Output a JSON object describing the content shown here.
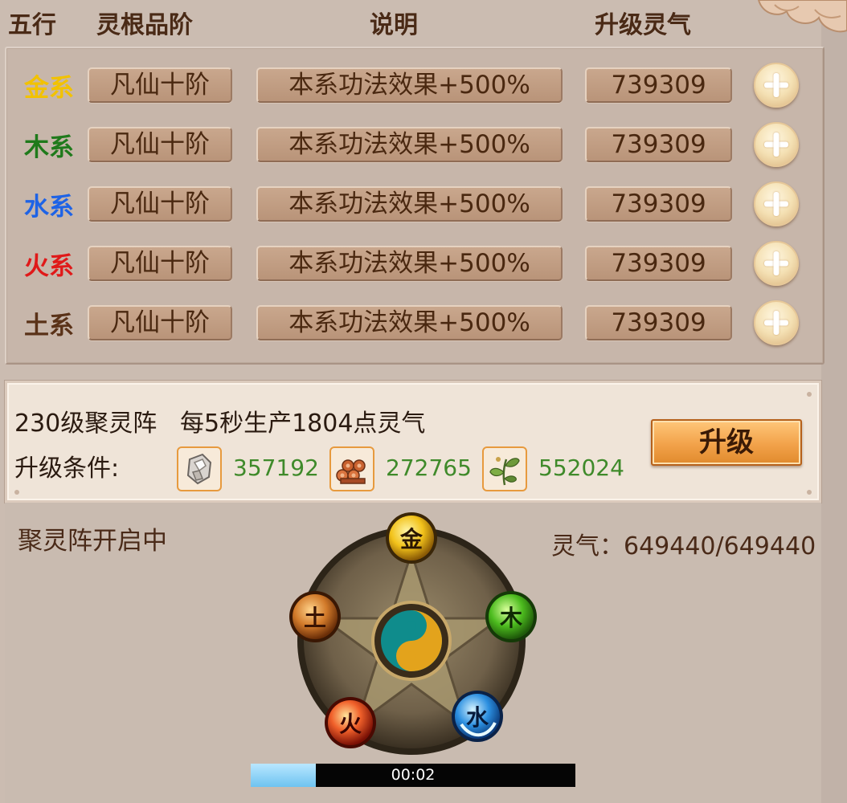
{
  "header": {
    "col_element": "五行",
    "col_rank": "灵根品阶",
    "col_desc": "说明",
    "col_cost": "升级灵气"
  },
  "elements": [
    {
      "name": "金系",
      "rank": "凡仙十阶",
      "desc": "本系功法效果+500%",
      "cost": "739309",
      "color": "#f2c200"
    },
    {
      "name": "木系",
      "rank": "凡仙十阶",
      "desc": "本系功法效果+500%",
      "cost": "739309",
      "color": "#1f7a1b"
    },
    {
      "name": "水系",
      "rank": "凡仙十阶",
      "desc": "本系功法效果+500%",
      "cost": "739309",
      "color": "#1e63e6"
    },
    {
      "name": "火系",
      "rank": "凡仙十阶",
      "desc": "本系功法效果+500%",
      "cost": "739309",
      "color": "#e01919"
    },
    {
      "name": "土系",
      "rank": "凡仙十阶",
      "desc": "本系功法效果+500%",
      "cost": "739309",
      "color": "#5a3218"
    }
  ],
  "formation": {
    "title": "230级聚灵阵",
    "production": "每5秒生产1804点灵气",
    "req_label": "升级条件:",
    "requirements": [
      {
        "icon": "ore-icon",
        "amount": "357192"
      },
      {
        "icon": "wood-logs-icon",
        "amount": "272765"
      },
      {
        "icon": "herb-icon",
        "amount": "552024"
      }
    ],
    "upgrade_label": "升级"
  },
  "status": {
    "text": "聚灵阵开启中",
    "qi": "灵气：649440/649440"
  },
  "wheel": {
    "nodes": [
      {
        "name": "金",
        "icon": "gold-orb-icon"
      },
      {
        "name": "木",
        "icon": "wood-orb-icon"
      },
      {
        "name": "水",
        "icon": "water-orb-icon"
      },
      {
        "name": "火",
        "icon": "fire-orb-icon"
      },
      {
        "name": "土",
        "icon": "earth-orb-icon"
      }
    ],
    "center_icon": "yin-yang-icon"
  },
  "timer": {
    "text": "00:02",
    "progress": 0.2
  }
}
